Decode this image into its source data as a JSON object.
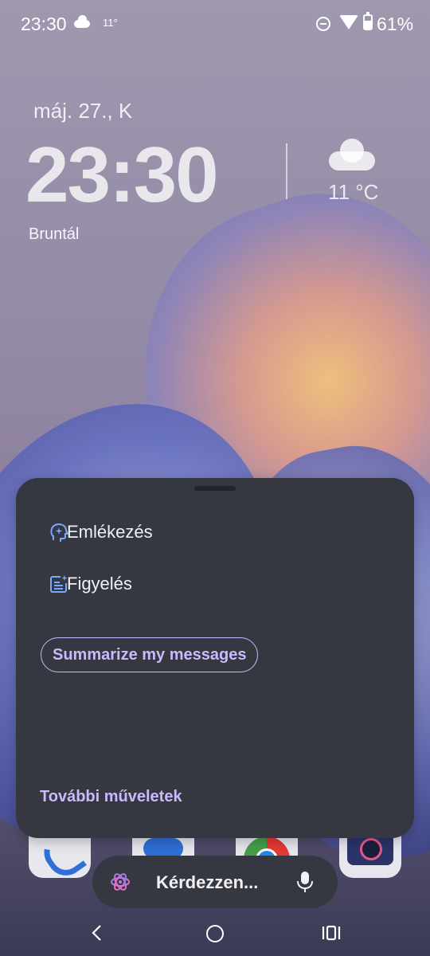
{
  "status_bar": {
    "time": "23:30",
    "weather_icon": "cloud-icon",
    "temperature": "11°",
    "battery_percent": "61%"
  },
  "lock_clock": {
    "date": "máj. 27., K",
    "time": "23:30",
    "weather_temp": "11 °C",
    "location": "Bruntál"
  },
  "sheet": {
    "items": [
      {
        "label": "Emlékezés",
        "icon": "brain-sparkle-icon"
      },
      {
        "label": "Figyelés",
        "icon": "notes-sparkle-icon"
      }
    ],
    "chip": "Summarize my messages",
    "more_actions": "További műveletek"
  },
  "search": {
    "placeholder": "Kérdezzen...",
    "left_icon": "gemini-icon",
    "right_icon": "mic-icon"
  },
  "colors": {
    "sheet_bg": "#363841",
    "accent": "#cbb8ff",
    "icon_blue": "#7ba7ff"
  }
}
